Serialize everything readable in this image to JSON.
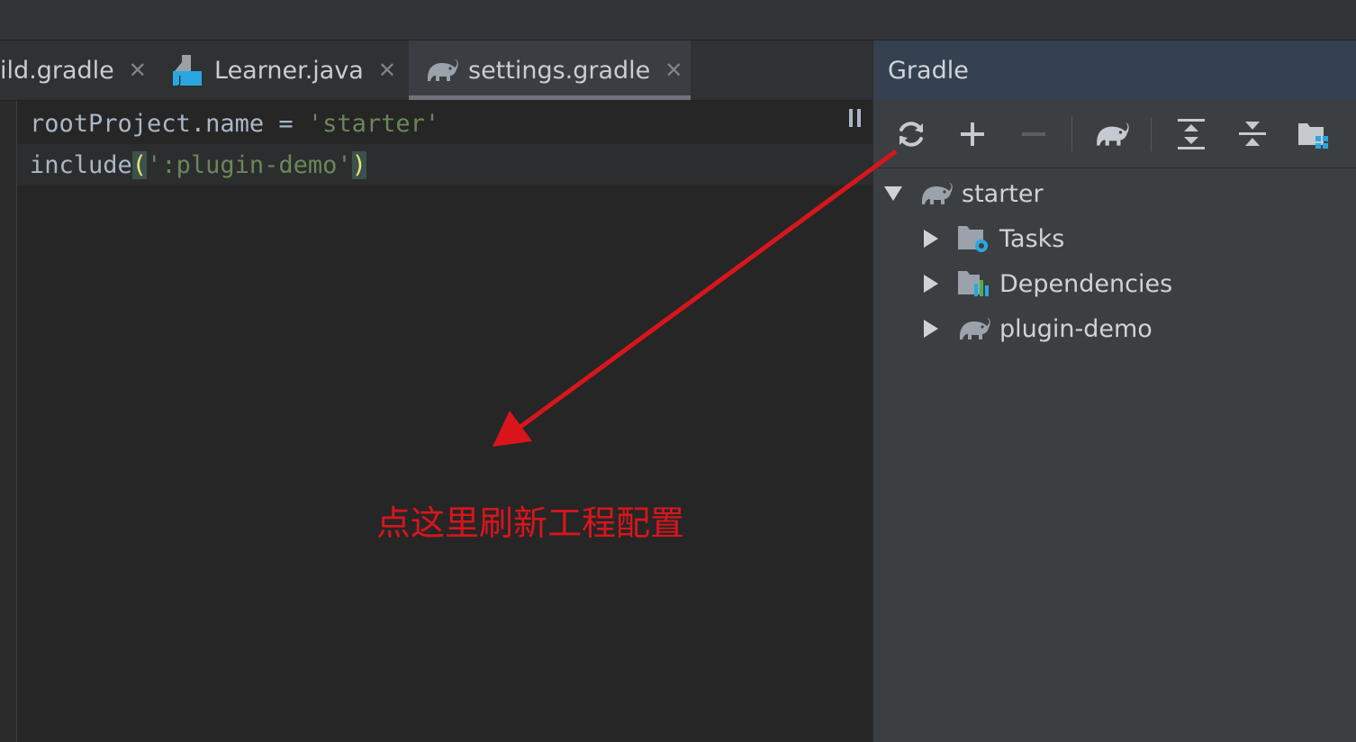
{
  "tabs": [
    {
      "label": "ild.gradle",
      "icon": "gradle-file-icon",
      "active": false
    },
    {
      "label": "Learner.java",
      "icon": "java-file-icon",
      "active": false
    },
    {
      "label": "settings.gradle",
      "icon": "gradle-elephant-icon",
      "active": true
    }
  ],
  "close_glyph": "✕",
  "editor": {
    "line1": {
      "ident": "rootProject.name",
      "op": " = ",
      "str": "'starter'"
    },
    "line2": {
      "func": "include",
      "open": "(",
      "str": "':plugin-demo'",
      "close": ")"
    }
  },
  "gradle_panel": {
    "title": "Gradle",
    "toolbar": [
      "refresh-icon",
      "add-icon",
      "remove-icon",
      "gradle-elephant-icon",
      "expand-all-icon",
      "collapse-all-icon",
      "settings-folder-icon"
    ],
    "tree": [
      {
        "label": "starter",
        "icon": "gradle-elephant-icon",
        "expanded": true,
        "level": 0
      },
      {
        "label": "Tasks",
        "icon": "tasks-folder-icon",
        "expanded": false,
        "level": 1
      },
      {
        "label": "Dependencies",
        "icon": "dependencies-icon",
        "expanded": false,
        "level": 1
      },
      {
        "label": "plugin-demo",
        "icon": "gradle-elephant-icon",
        "expanded": false,
        "level": 1
      }
    ]
  },
  "annotation": {
    "text": "点这里刷新工程配置",
    "color": "#d9151c"
  },
  "colors": {
    "string": "#6a8759",
    "paren": "#e8e07a",
    "panel_header": "#354050",
    "accent_blue": "#2aa7e0"
  }
}
